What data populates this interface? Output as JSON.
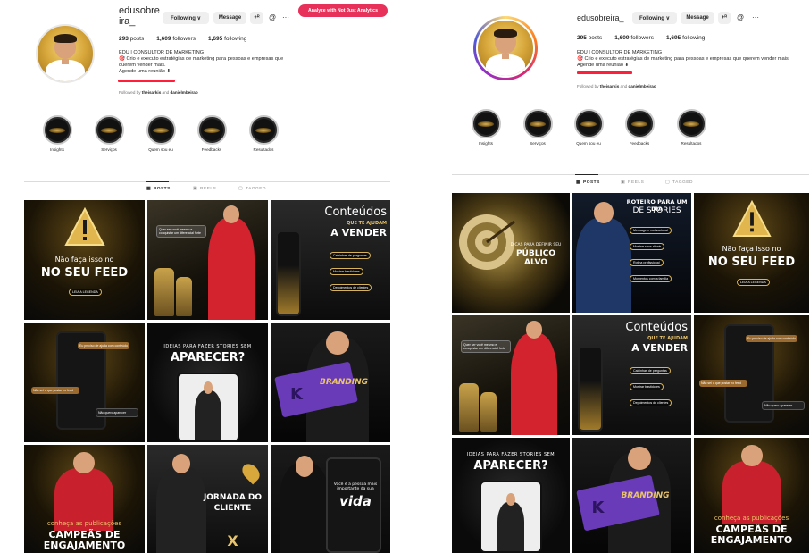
{
  "left": {
    "username": "edusobre\nira_",
    "buttons": {
      "following": "Following ∨",
      "message": "Message",
      "add_user": "+ᴿ",
      "threads": "@",
      "more": "···"
    },
    "analyze": "Analyze with Not Just Analytics",
    "stats": {
      "posts": "293",
      "posts_label": "posts",
      "followers": "1,609",
      "followers_label": "followers",
      "following": "1,695",
      "following_label": "following"
    },
    "bio": {
      "name": "EDU | CONSULTOR DE MARKETING",
      "line1": "🎯 Crio e executo estratégias de marketing para pessoas e empresas que",
      "line2": "querem vender mais.",
      "line3": "Agende uma reunião ⬇"
    },
    "followed_by": {
      "prefix": "Followed by",
      "user1": "theisarkis",
      "and": "and",
      "user2": "danielmbeirao"
    },
    "highlights": [
      "Insights",
      "Serviços",
      "Quem sou eu",
      "Feedbacks",
      "Resultados"
    ],
    "tabs": {
      "posts": "POSTS",
      "reels": "REELS",
      "tagged": "TAGGED"
    },
    "posts": [
      {
        "caption1": "Não faça isso no",
        "caption2": "NO SEU FEED",
        "button": "LEIA A LEGENDA"
      },
      {
        "quote": "Quer ser você mesmo e conquistar um diferencial forte"
      },
      {
        "caption1": "Conteúdos",
        "caption2": "QUE TE AJUDAM",
        "caption3": "A VENDER",
        "items": [
          "Caixinhas de perguntas",
          "Mostrar bastidores",
          "Depoimentos de clientes"
        ]
      },
      {
        "bubble1": "Eu preciso de ajuda com conteúdo",
        "bubble2": "Não sei o que postar no feed",
        "bubble3": "Não quero aparecer"
      },
      {
        "caption1": "IDEIAS PARA FAZER STORIES SEM",
        "caption2": "APARECER?"
      },
      {
        "caption1": "BRANDING",
        "caption2": "K"
      },
      {
        "caption1": "conheça as publicações",
        "caption2": "CAMPEÃS DE",
        "caption3": "ENGAJAMENTO"
      },
      {
        "caption1": "JORNADA DO",
        "caption2": "CLIENTE",
        "caption3": "X"
      },
      {
        "caption1": "Você é a pessoa mais importante da sua",
        "caption2": "vida"
      }
    ]
  },
  "right": {
    "username": "edusobreira_",
    "buttons": {
      "following": "Following ∨",
      "message": "Message",
      "add_user": "+ᴿ",
      "threads": "@",
      "more": "···"
    },
    "stats": {
      "posts": "295",
      "posts_label": "posts",
      "followers": "1,609",
      "followers_label": "followers",
      "following": "1,695",
      "following_label": "following"
    },
    "bio": {
      "name": "EDU | CONSULTOR DE MARKETING",
      "line1": "🎯 Crio e executo estratégias de marketing para pessoas e empresas que querem vender mais.",
      "line2": "Agende uma reunião ⬇"
    },
    "followed_by": {
      "prefix": "Followed by",
      "user1": "theisarkis",
      "and": "and",
      "user2": "danielmbeirao"
    },
    "highlights": [
      "Insights",
      "Serviços",
      "Quem sou eu",
      "Feedbacks",
      "Resultados"
    ],
    "tabs": {
      "posts": "POSTS",
      "reels": "REELS",
      "tagged": "TAGGED"
    },
    "posts": [
      {
        "caption1": "DICAS PARA DEFINIR SEU",
        "caption2": "PÚBLICO ALVO"
      },
      {
        "caption1": "ROTEIRO PARA UM DIA",
        "caption2": "DE STORIES",
        "items": [
          "Mensagem motivacional",
          "Mostrar seus rituais",
          "Rotina profissional",
          "Momentos com a família"
        ]
      },
      {
        "caption1": "Não faça isso no",
        "caption2": "NO SEU FEED",
        "button": "LEIA A LEGENDA"
      },
      {
        "quote": "Quer ser você mesmo e conquistar um diferencial forte"
      },
      {
        "caption1": "Conteúdos",
        "caption2": "QUE TE AJUDAM",
        "caption3": "A VENDER",
        "items": [
          "Caixinhas de perguntas",
          "Mostrar bastidores",
          "Depoimentos de clientes"
        ]
      },
      {
        "bubble1": "Eu preciso de ajuda com conteúdo",
        "bubble2": "Não sei o que postar no feed",
        "bubble3": "Não quero aparecer"
      },
      {
        "caption1": "IDEIAS PARA FAZER STORIES SEM",
        "caption2": "APARECER?"
      },
      {
        "caption1": "BRANDING",
        "caption2": "K"
      },
      {
        "caption1": "conheça as publicações",
        "caption2": "CAMPEÃS DE",
        "caption3": "ENGAJAMENTO"
      }
    ]
  },
  "colors": {
    "analyze_bg": "#e8315a",
    "redline": "#ff1f3a",
    "gold": "#e9c46a"
  }
}
